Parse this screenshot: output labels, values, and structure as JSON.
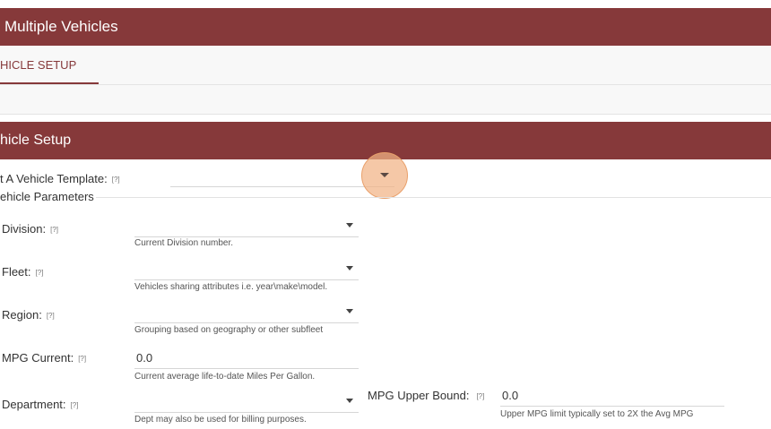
{
  "page": {
    "title": "Multiple Vehicles"
  },
  "tabs": [
    {
      "label": "HICLE SETUP",
      "active": true
    }
  ],
  "section": {
    "title": "hicle Setup",
    "template": {
      "label": "t A Vehicle Template:",
      "help": "[?]"
    },
    "group_title": "ehicle Parameters"
  },
  "fields": {
    "division": {
      "label": "Division:",
      "help": "[?]",
      "hint": "Current Division number."
    },
    "fleet": {
      "label": "Fleet:",
      "help": "[?]",
      "hint": "Vehicles sharing attributes i.e. year\\make\\model."
    },
    "region": {
      "label": "Region:",
      "help": "[?]",
      "hint": "Grouping based on geography or other subfleet"
    },
    "mpg_current": {
      "label": "MPG Current:",
      "help": "[?]",
      "value": "0.0",
      "hint": "Current average life-to-date Miles Per Gallon."
    },
    "department": {
      "label": "Department:",
      "help": "[?]",
      "hint": "Dept may also be used for billing purposes."
    },
    "mpg_upper": {
      "label": "MPG Upper Bound:",
      "help": "[?]",
      "value": "0.0",
      "hint": "Upper MPG limit typically set to 2X the Avg MPG"
    }
  },
  "colors": {
    "brand": "#86393a",
    "click_marker": "#f1b385"
  },
  "icons": {
    "dropdown": "caret-down-icon"
  }
}
